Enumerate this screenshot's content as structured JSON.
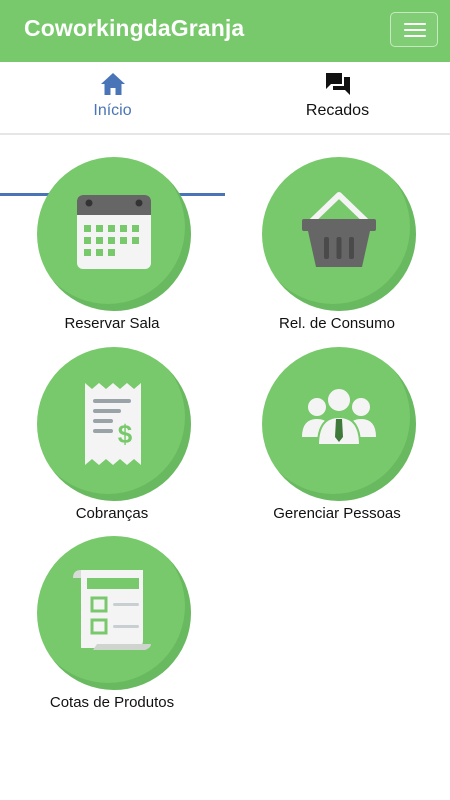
{
  "header": {
    "brand": "CoworkingdaGranja",
    "menu_icon": "hamburger-menu-icon",
    "color": "#77c96b"
  },
  "tabs": [
    {
      "label": "Início",
      "icon": "home-icon",
      "active": true,
      "color": "#4a74b8"
    },
    {
      "label": "Recados",
      "icon": "chat-bubbles-icon",
      "active": false
    }
  ],
  "tiles": [
    {
      "label": "Reservar Sala",
      "icon": "calendar-icon"
    },
    {
      "label": "Rel. de Consumo",
      "icon": "shopping-basket-icon"
    },
    {
      "label": "Cobranças",
      "icon": "receipt-dollar-icon"
    },
    {
      "label": "Gerenciar Pessoas",
      "icon": "people-group-icon"
    },
    {
      "label": "Cotas de Produtos",
      "icon": "checklist-icon"
    }
  ]
}
